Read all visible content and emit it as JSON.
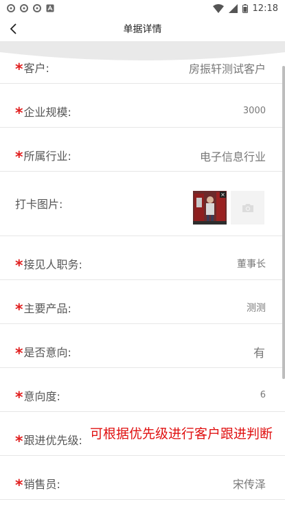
{
  "status_bar": {
    "time": "12:18"
  },
  "header": {
    "title": "单据详情"
  },
  "fields": [
    {
      "label": "客户:",
      "value": "房振轩测试客户",
      "required": true
    },
    {
      "label": "企业规模:",
      "value": "3000",
      "required": true
    },
    {
      "label": "所属行业:",
      "value": "电子信息行业",
      "required": true
    },
    {
      "label": "打卡图片:",
      "required": false
    },
    {
      "label": "接见人职务:",
      "value": "董事长",
      "required": true
    },
    {
      "label": "主要产品:",
      "value": "测测",
      "required": true
    },
    {
      "label": "是否意向:",
      "value": "有",
      "required": true
    },
    {
      "label": "意向度:",
      "value": "6",
      "required": true
    },
    {
      "label": "跟进优先级:",
      "required": true
    },
    {
      "label": "销售员:",
      "value": "宋传泽",
      "required": true
    }
  ],
  "required_mark": "*",
  "annotation": "可根据优先级进行客户跟进判断",
  "icons": {
    "back": "back-arrow-icon",
    "camera": "camera-icon",
    "close": "close-icon",
    "wifi": "wifi-icon",
    "signal": "signal-icon",
    "battery": "battery-icon"
  },
  "colors": {
    "required": "#e02020",
    "annotation": "#e01010"
  }
}
